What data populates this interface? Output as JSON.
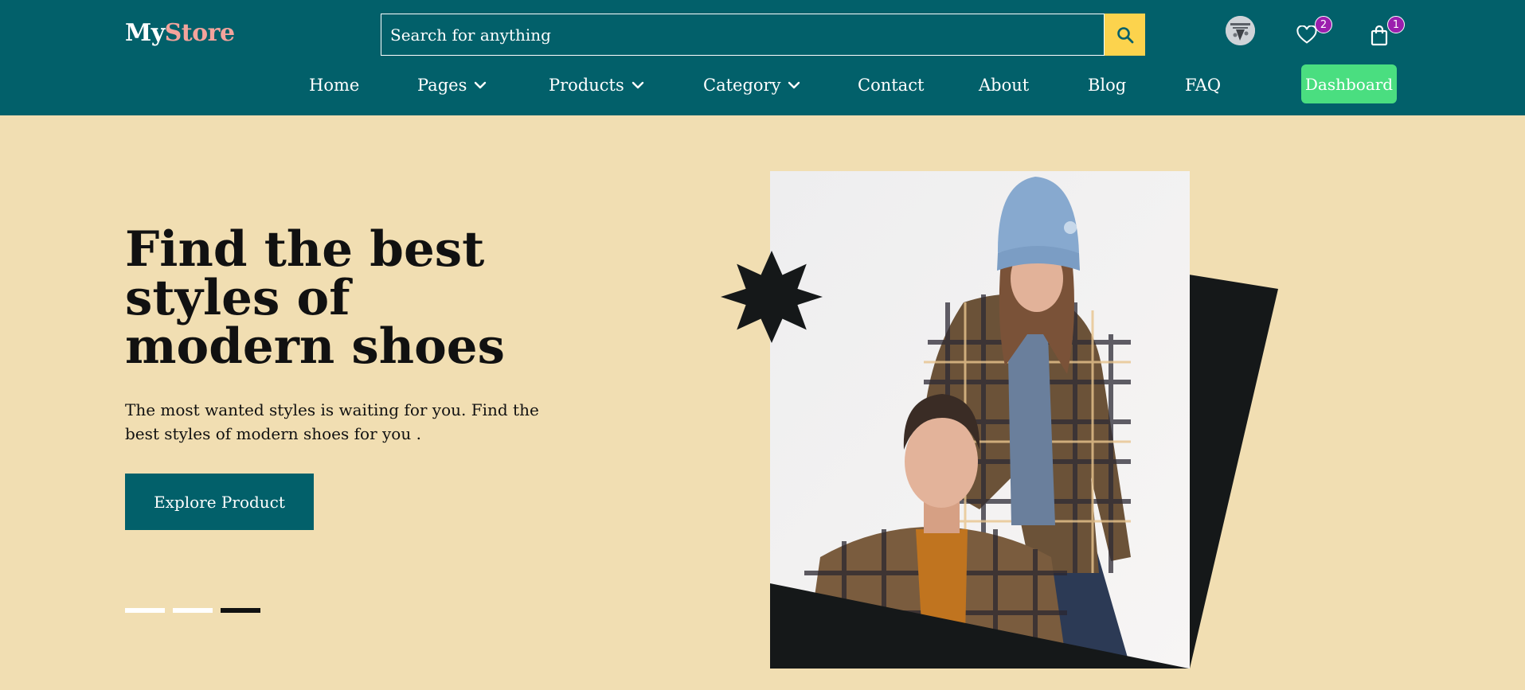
{
  "brand": {
    "part1": "My",
    "part2": "Store"
  },
  "search": {
    "placeholder": "Search for anything",
    "icon": "search-icon"
  },
  "header_icons": {
    "avatar": "user-avatar",
    "wishlist": {
      "icon": "heart-icon",
      "count": "2"
    },
    "cart": {
      "icon": "shopping-bag-icon",
      "count": "1"
    }
  },
  "nav": {
    "items": [
      {
        "label": "Home"
      },
      {
        "label": "Pages",
        "dropdown": true
      },
      {
        "label": "Products",
        "dropdown": true
      },
      {
        "label": "Category",
        "dropdown": true
      },
      {
        "label": "Contact"
      },
      {
        "label": "About"
      },
      {
        "label": "Blog"
      },
      {
        "label": "FAQ"
      }
    ],
    "dashboard_label": "Dashboard"
  },
  "hero": {
    "title": "Find the best styles of modern shoes",
    "subtitle": "The most wanted styles is waiting for you. Find the best styles of modern shoes for you .",
    "cta_label": "Explore Product",
    "slides": {
      "count": 3,
      "active_index": 2
    }
  },
  "colors": {
    "header_bg": "#02606a",
    "page_bg": "#f1deb2",
    "search_button": "#fcd34d",
    "dashboard_button": "#4ade80",
    "badge": "#9b1fae",
    "logo_accent": "#f3a39c",
    "dark_shape": "#151819"
  }
}
